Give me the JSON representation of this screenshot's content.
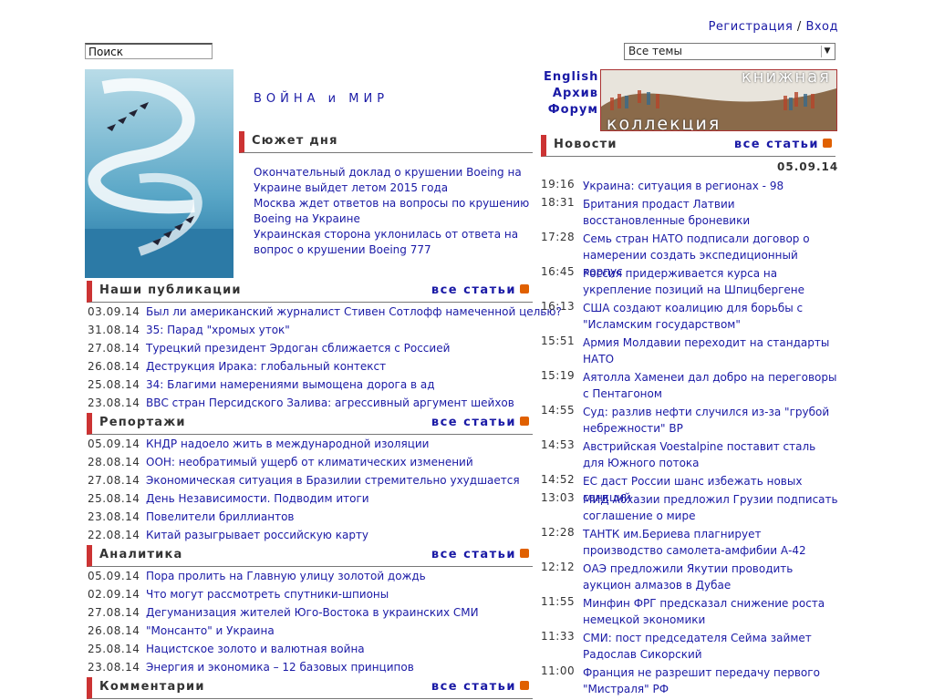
{
  "auth": {
    "register": "Регистрация",
    "sep": " / ",
    "login": "Вход"
  },
  "search": {
    "value": "Поиск"
  },
  "topics": {
    "selected": "Все темы"
  },
  "site_title": "ВОЙНА и МИР",
  "right_links": {
    "english": "English",
    "archive": "Архив",
    "forum": "Форум"
  },
  "banner": {
    "line1": "книжная",
    "line2": "коллекция"
  },
  "story": {
    "heading": "Сюжет дня",
    "items": [
      "Окончательный доклад о крушении Boeing на Украине выйдет летом 2015 года",
      "Москва ждет ответов на вопросы по крушению Boeing на Украине",
      "Украинская сторона уклонилась от ответа на вопрос о крушении Boeing 777"
    ]
  },
  "all_articles": "все статьи",
  "publications": {
    "heading": "Наши публикации",
    "rows": [
      {
        "date": "03.09.14",
        "title": "Был ли американский журналист Стивен Сотлофф намеченной целью?"
      },
      {
        "date": "31.08.14",
        "title": "35: Парад \"хромых уток\""
      },
      {
        "date": "27.08.14",
        "title": "Турецкий президент Эрдоган сближается с Россией"
      },
      {
        "date": "26.08.14",
        "title": "Деструкция Ирака: глобальный контекст"
      },
      {
        "date": "25.08.14",
        "title": "34: Благими намерениями вымощена дорога в ад"
      },
      {
        "date": "23.08.14",
        "title": "ВВС стран Персидского Залива: агрессивный аргумент шейхов"
      }
    ]
  },
  "reports": {
    "heading": "Репортажи",
    "rows": [
      {
        "date": "05.09.14",
        "title": "КНДР надоело жить в международной изоляции"
      },
      {
        "date": "28.08.14",
        "title": "ООН: необратимый ущерб от климатических изменений"
      },
      {
        "date": "27.08.14",
        "title": "Экономическая ситуация в Бразилии стремительно ухудшается"
      },
      {
        "date": "25.08.14",
        "title": "День Независимости. Подводим итоги"
      },
      {
        "date": "23.08.14",
        "title": "Повелители бриллиантов"
      },
      {
        "date": "22.08.14",
        "title": "Китай разыгрывает российскую карту"
      }
    ]
  },
  "analytics": {
    "heading": "Аналитика",
    "rows": [
      {
        "date": "05.09.14",
        "title": "Пора пролить на Главную улицу золотой дождь"
      },
      {
        "date": "02.09.14",
        "title": "Что могут рассмотреть спутники-шпионы"
      },
      {
        "date": "27.08.14",
        "title": "Дегуманизация жителей Юго-Востока в украинских СМИ"
      },
      {
        "date": "26.08.14",
        "title": "\"Монсанто\" и Украина"
      },
      {
        "date": "25.08.14",
        "title": "Нацистское золото и валютная война"
      },
      {
        "date": "23.08.14",
        "title": "Энергия и экономика – 12 базовых принципов"
      }
    ]
  },
  "comments": {
    "heading": "Комментарии"
  },
  "news": {
    "heading": "Новости",
    "date": "05.09.14",
    "rows": [
      {
        "time": "19:16",
        "text": "Украина: ситуация в регионах - 98"
      },
      {
        "time": "18:31",
        "text": "Британия продаст Латвии восстановленные броневики"
      },
      {
        "time": "17:28",
        "text": "Семь стран НАТО подписали договор о намерении создать экспедиционный корпус"
      },
      {
        "time": "16:45",
        "text": "Россия придерживается курса на укрепление позиций на Шпицбергене"
      },
      {
        "time": "16:13",
        "text": "США создают коалицию для борьбы с \"Исламским государством\""
      },
      {
        "time": "15:51",
        "text": "Армия Молдавии переходит на стандарты НАТО"
      },
      {
        "time": "15:19",
        "text": "Аятолла Хаменеи дал добро на переговоры с Пентагоном"
      },
      {
        "time": "14:55",
        "text": "Суд: разлив нефти случился из-за \"грубой небрежности\" BP"
      },
      {
        "time": "14:53",
        "text": "Австрийская Voestalpine поставит сталь для Южного потока"
      },
      {
        "time": "14:52",
        "text": "ЕС даст России шанс избежать новых санкций"
      },
      {
        "time": "13:03",
        "text": "МИД Абхазии предложил Грузии подписать соглашение о мире"
      },
      {
        "time": "12:28",
        "text": "ТАНТК им.Бериева плагнирует производство самолета-амфибии А-42"
      },
      {
        "time": "12:12",
        "text": "ОАЭ предложили Якутии проводить аукцион алмазов в Дубае"
      },
      {
        "time": "11:55",
        "text": "Минфин ФРГ предсказал снижение роста немецкой экономики"
      },
      {
        "time": "11:33",
        "text": "СМИ: пост председателя Сейма займет Радослав Сикорский"
      },
      {
        "time": "11:00",
        "text": "Франция не разрешит передачу первого \"Мистраля\" РФ"
      }
    ]
  }
}
